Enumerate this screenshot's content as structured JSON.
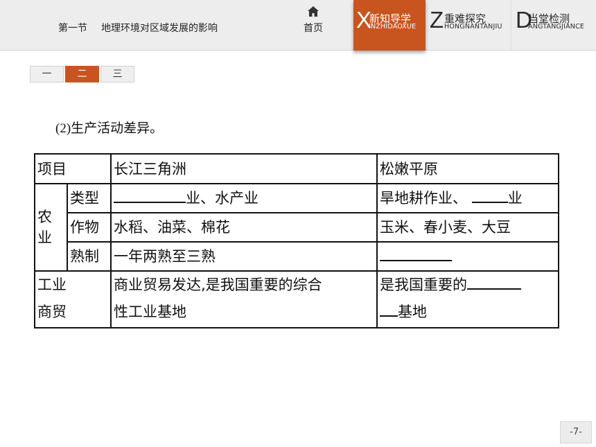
{
  "header": {
    "lesson_number": "第一节",
    "lesson_title": "地理环境对区域发展的影响",
    "home_label": "首页",
    "tabs": [
      {
        "letter": "X",
        "label": "新知导学",
        "sub": "INZHIDAOXUE",
        "active": true
      },
      {
        "letter": "Z",
        "label": "重难探究",
        "sub": "HONGNANTANJIU",
        "active": false
      },
      {
        "letter": "D",
        "label": "当堂检测",
        "sub": "ANGTANGJIANCE",
        "active": false
      }
    ],
    "active_tab_color": "#c8551f"
  },
  "pager": {
    "items": [
      "一",
      "二",
      "三"
    ],
    "active_index": 1
  },
  "content": {
    "subheading": "(2)生产活动差异。",
    "table": {
      "header": {
        "item": "项目",
        "col1": "长江三角洲",
        "col2": "松嫩平原"
      },
      "agriculture": {
        "group_label_1": "农",
        "group_label_2": "业",
        "rows": [
          {
            "label": "类型",
            "col1_suffix": "业、水产业",
            "col2_prefix": "旱地耕作业、",
            "col2_suffix": "业"
          },
          {
            "label": "作物",
            "col1": "水稻、油菜、棉花",
            "col2": "玉米、春小麦、大豆"
          },
          {
            "label": "熟制",
            "col1": "一年两熟至三熟",
            "col2": ""
          }
        ]
      },
      "industry": {
        "label_1": "工业",
        "label_2": "商贸",
        "col1_line1": "商业贸易发达,是我国重要的综合",
        "col1_line2": "性工业基地",
        "col2_prefix": "是我国重要的",
        "col2_suffix": "基地"
      }
    }
  },
  "footer": {
    "page_number": "-7-"
  }
}
